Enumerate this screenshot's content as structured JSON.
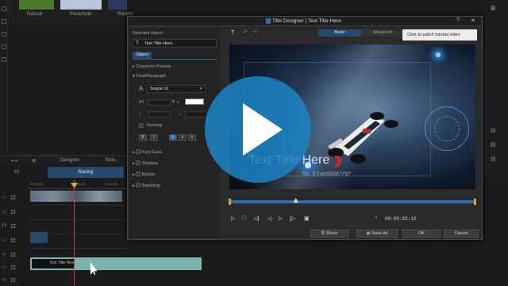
{
  "library": {
    "items": [
      {
        "label": "Natural",
        "color": "#4a7a2a"
      },
      {
        "label": "Parachute",
        "color": "#b9c6d8"
      },
      {
        "label": "Racing",
        "color": "#2b3a5a"
      }
    ]
  },
  "editor": {
    "mode_designer": "Designer",
    "mode_tools": "Tools",
    "tab_number": "01",
    "active_tab": "Racing",
    "clip_title": "Text Title Here"
  },
  "dialog": {
    "title": "Title Designer | Text Title Here",
    "help": "?",
    "close": "✕",
    "selected_object_label": "Selected object:",
    "selected_object_value": "Text Title Here",
    "object_tab": "Object",
    "character_presets": "Character Presets",
    "font_paragraph": "Font/Paragraph",
    "font_name": "Segoe UI",
    "kerning": "Kerning",
    "bold": "B",
    "italic": "I",
    "sections": [
      "Font Face",
      "Shadow",
      "Border",
      "Backdrop"
    ],
    "mode_basic": "Basic",
    "mode_advanced": "Advanced",
    "tooltip": "Click to watch tutorial video",
    "preview_title": "Text Title Here",
    "preview_caption": "No. 6'14e00087797",
    "timecode": "00:00:02:16",
    "buttons": {
      "share": "Share",
      "save_as": "Save As",
      "ok": "OK",
      "cancel": "Cancel"
    },
    "scrub_position": 0.27
  },
  "overlay": {
    "accent": "#1c84c4"
  }
}
